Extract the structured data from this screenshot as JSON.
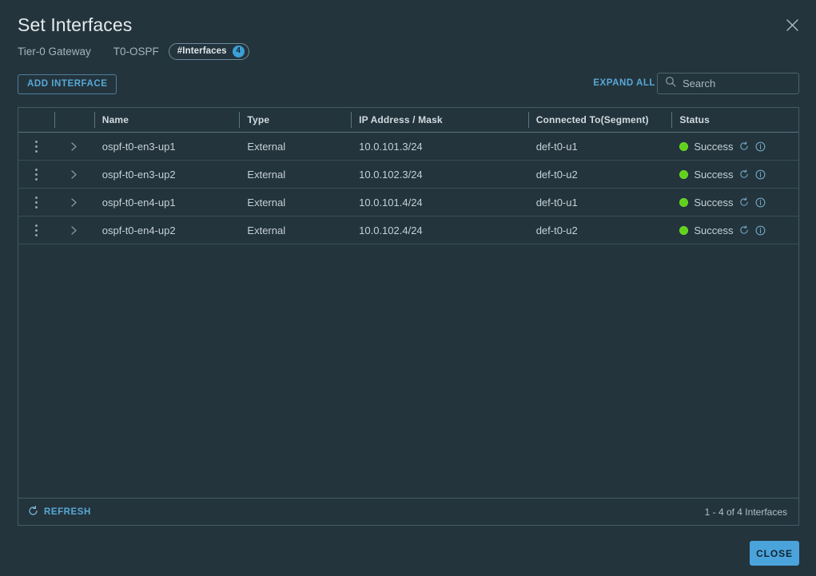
{
  "dialog": {
    "title": "Set Interfaces",
    "close_icon": "close-x-icon"
  },
  "breadcrumb": {
    "gateway_type": "Tier-0 Gateway",
    "gateway_name": "T0-OSPF",
    "chip_label": "#Interfaces",
    "chip_count": "4"
  },
  "toolbar": {
    "add_interface_label": "ADD INTERFACE",
    "expand_all_label": "EXPAND ALL",
    "search_placeholder": "Search",
    "search_value": "",
    "search_icon": "search-icon"
  },
  "table": {
    "columns": [
      {
        "key": "menu",
        "label": ""
      },
      {
        "key": "expand",
        "label": ""
      },
      {
        "key": "name",
        "label": "Name"
      },
      {
        "key": "type",
        "label": "Type"
      },
      {
        "key": "ip",
        "label": "IP Address / Mask"
      },
      {
        "key": "connected",
        "label": "Connected To(Segment)"
      },
      {
        "key": "status",
        "label": "Status"
      }
    ],
    "rows": [
      {
        "name": "ospf-t0-en3-up1",
        "type": "External",
        "ip": "10.0.101.3/24",
        "connected": "def-t0-u1",
        "status": "Success",
        "status_color": "#60d217"
      },
      {
        "name": "ospf-t0-en3-up2",
        "type": "External",
        "ip": "10.0.102.3/24",
        "connected": "def-t0-u2",
        "status": "Success",
        "status_color": "#60d217"
      },
      {
        "name": "ospf-t0-en4-up1",
        "type": "External",
        "ip": "10.0.101.4/24",
        "connected": "def-t0-u1",
        "status": "Success",
        "status_color": "#60d217"
      },
      {
        "name": "ospf-t0-en4-up2",
        "type": "External",
        "ip": "10.0.102.4/24",
        "connected": "def-t0-u2",
        "status": "Success",
        "status_color": "#60d217"
      }
    ],
    "footer": {
      "refresh_label": "REFRESH",
      "refresh_icon": "refresh-icon",
      "count_text": "1 - 4 of 4 Interfaces"
    }
  },
  "footer": {
    "close_label": "CLOSE"
  },
  "colors": {
    "page_background": "#23343d",
    "accent": "#58a8d6",
    "primary_button": "#4ba3dc",
    "success": "#60d217",
    "border": "#455b66"
  }
}
